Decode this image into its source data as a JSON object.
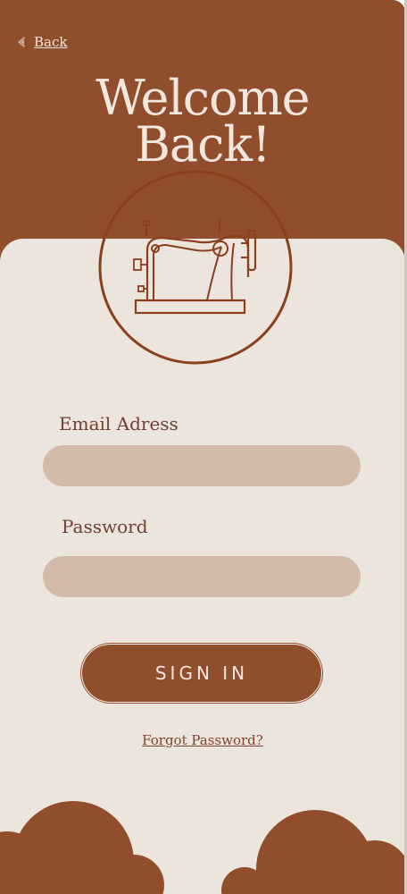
{
  "header": {
    "back_label": "Back",
    "title_line1": "Welcome",
    "title_line2": "Back!",
    "emblem_icon": "sewing-machine-icon"
  },
  "form": {
    "email_label": "Email Adress",
    "email_value": "",
    "password_label": "Password",
    "password_value": "",
    "signin_label": "SIGN IN",
    "forgot_label": "Forgot Password?"
  },
  "colors": {
    "brand_brown": "#914e2c",
    "background_cream": "#ece5dd",
    "field_fill": "#d3bbab",
    "title_text": "#f1e7df"
  }
}
